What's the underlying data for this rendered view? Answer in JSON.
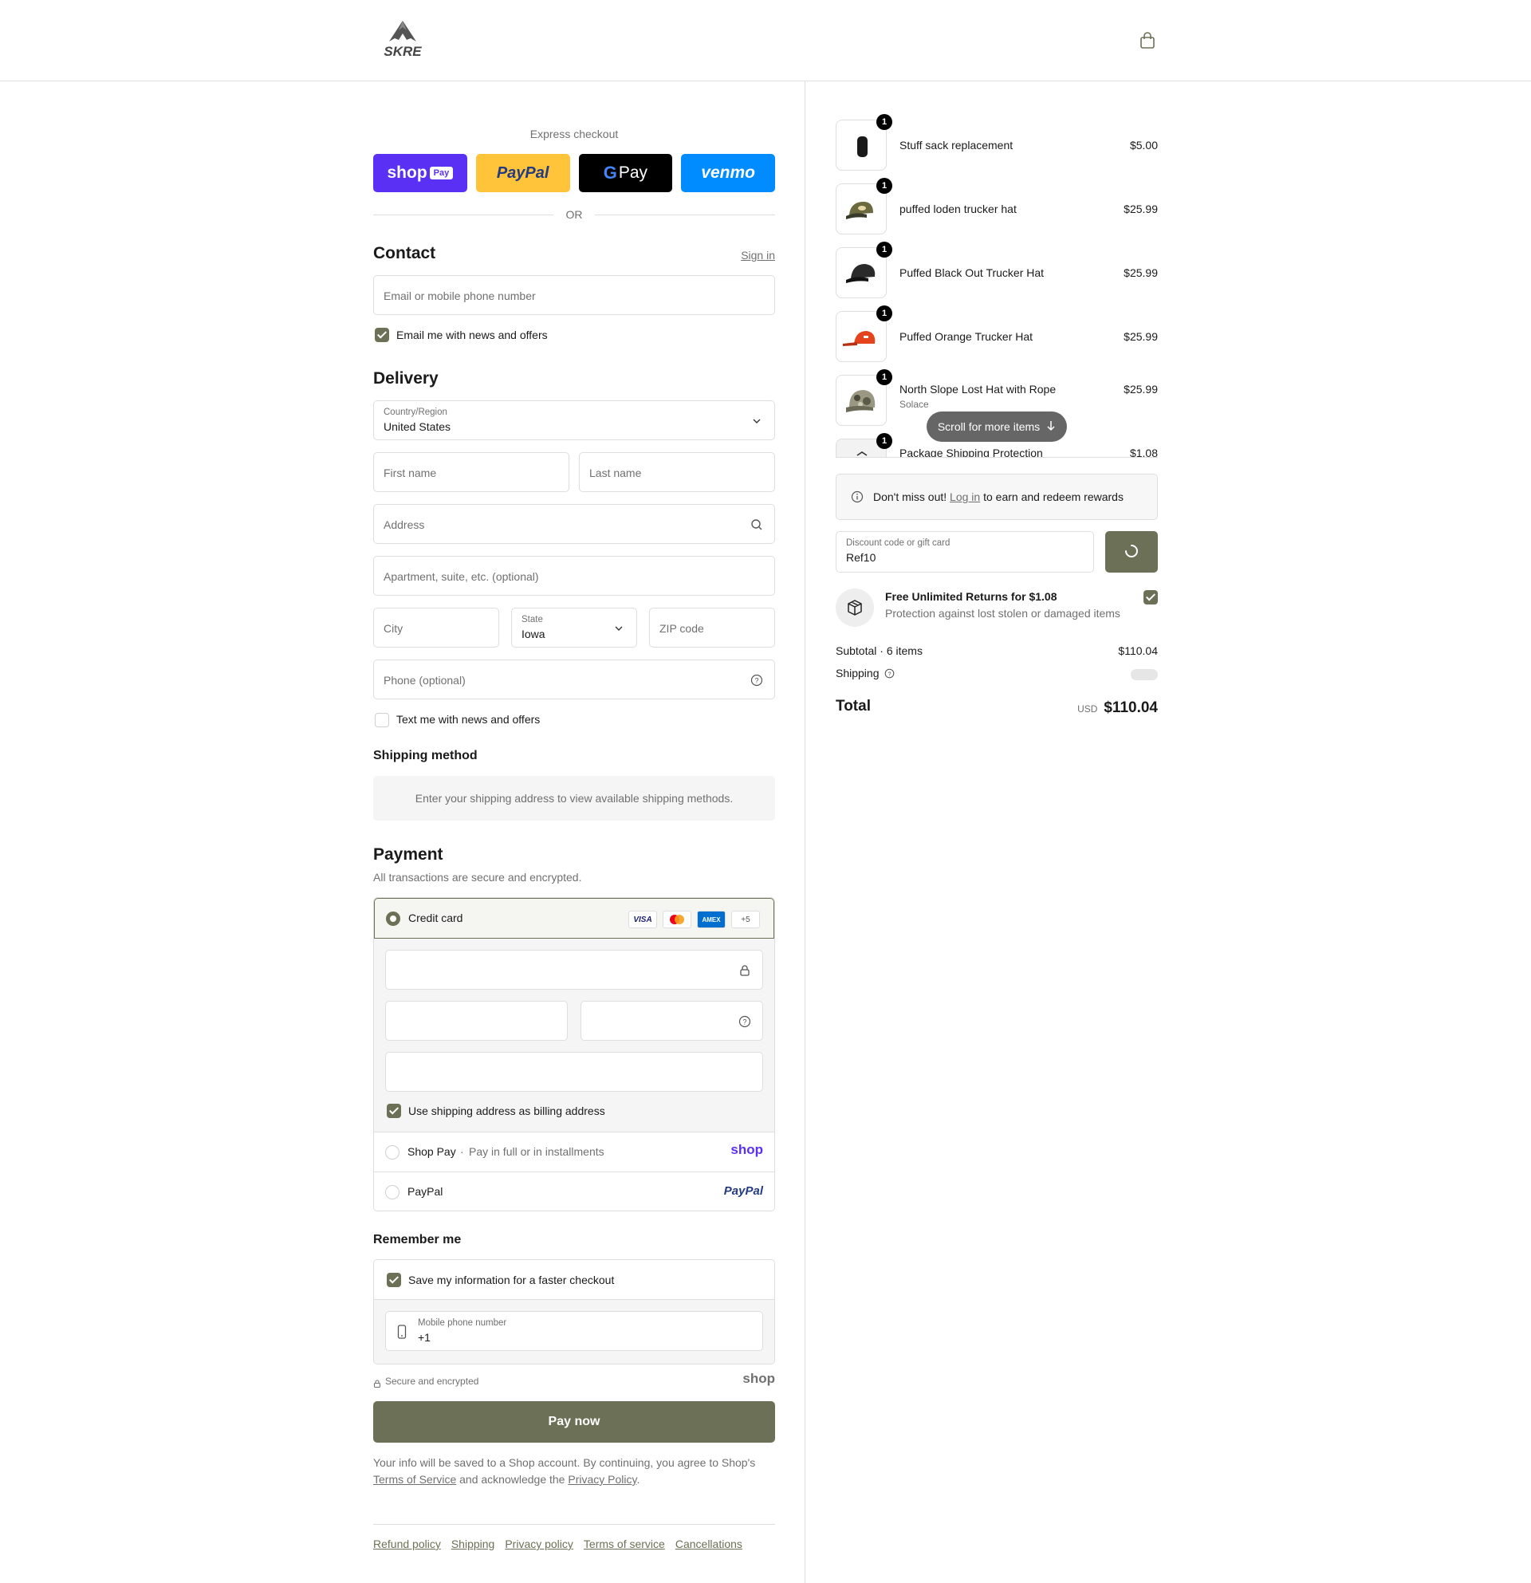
{
  "brand": {
    "logo_text": "SKRE"
  },
  "express": {
    "title": "Express checkout",
    "or": "OR",
    "shop_pay": "shop",
    "shop_pay_badge": "Pay",
    "paypal": "PayPal",
    "gpay": "Pay",
    "venmo": "venmo"
  },
  "contact": {
    "heading": "Contact",
    "sign_in": "Sign in",
    "email_placeholder": "Email or mobile phone number",
    "email_optin": "Email me with news and offers",
    "email_optin_checked": true
  },
  "delivery": {
    "heading": "Delivery",
    "country_label": "Country/Region",
    "country_value": "United States",
    "first_name": "First name",
    "last_name": "Last name",
    "address": "Address",
    "apartment": "Apartment, suite, etc. (optional)",
    "city": "City",
    "state_label": "State",
    "state_value": "Iowa",
    "zip": "ZIP code",
    "phone": "Phone (optional)",
    "sms_optin": "Text me with news and offers",
    "sms_optin_checked": false
  },
  "shipping_method": {
    "heading": "Shipping method",
    "message": "Enter your shipping address to view available shipping methods."
  },
  "payment": {
    "heading": "Payment",
    "subtitle": "All transactions are secure and encrypted.",
    "credit_card": "Credit card",
    "brands": [
      "VISA",
      "MC",
      "AMEX",
      "+5"
    ],
    "billing_same": "Use shipping address as billing address",
    "shop_pay": "Shop Pay",
    "shop_pay_sep": "·",
    "shop_pay_sub": "Pay in full or in installments",
    "shop_pay_logo": "shop",
    "paypal": "PayPal",
    "paypal_logo": "PayPal"
  },
  "remember": {
    "heading": "Remember me",
    "save_info": "Save my information for a faster checkout",
    "mobile_label": "Mobile phone number",
    "mobile_value": "+1",
    "secure": "Secure and encrypted",
    "shop_logo": "shop"
  },
  "pay_now": "Pay now",
  "legal": {
    "line1": "Your info will be saved to a Shop account. By continuing, you agree to Shop's",
    "tos": "Terms of Service",
    "mid": "and acknowledge the",
    "privacy": "Privacy Policy",
    "end": "."
  },
  "footer": [
    "Refund policy",
    "Shipping",
    "Privacy policy",
    "Terms of service",
    "Cancellations"
  ],
  "cart": {
    "items": [
      {
        "name": "Stuff sack replacement",
        "sub": "",
        "price": "$5.00",
        "qty": "1",
        "color": "#1a1a1a"
      },
      {
        "name": "puffed loden trucker hat",
        "sub": "",
        "price": "$25.99",
        "qty": "1",
        "color": "#6b6a3e"
      },
      {
        "name": "Puffed Black Out Trucker Hat",
        "sub": "",
        "price": "$25.99",
        "qty": "1",
        "color": "#2a2a2a"
      },
      {
        "name": "Puffed Orange Trucker Hat",
        "sub": "",
        "price": "$25.99",
        "qty": "1",
        "color": "#e5431c"
      },
      {
        "name": "North Slope Lost Hat with Rope",
        "sub": "Solace",
        "price": "$25.99",
        "qty": "1",
        "color": "#7d7b68"
      },
      {
        "name": "Package Shipping Protection",
        "sub": "",
        "price": "$1.08",
        "qty": "1",
        "color": "#333"
      }
    ],
    "scroll_hint": "Scroll for more items",
    "rewards_pre": "Don't miss out!",
    "rewards_link": "Log in",
    "rewards_post": "to earn and redeem rewards",
    "discount_label": "Discount code or gift card",
    "discount_value": "Ref10",
    "protection_title": "Free Unlimited Returns for $1.08",
    "protection_sub": "Protection against lost stolen or damaged items",
    "protection_checked": true,
    "subtotal_label": "Subtotal · 6 items",
    "subtotal_value": "$110.04",
    "shipping_label": "Shipping",
    "total_label": "Total",
    "currency": "USD",
    "total_value": "$110.04"
  }
}
